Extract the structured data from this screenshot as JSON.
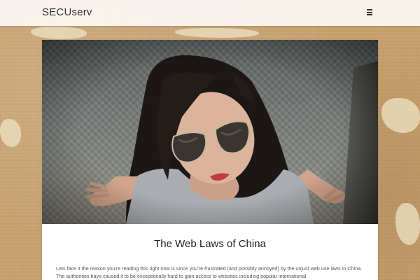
{
  "header": {
    "site_title": "SECUserv",
    "menu_icon": "hamburger-menu-icon"
  },
  "post": {
    "image_subject": "woman-with-aviator-sunglasses-photo",
    "title": "The Web Laws of China",
    "excerpt": "Lets face it the reason you’re reading this right now is since you’re frustrated (and possibly annoyed) by the unjust web use laws in China. The authorities have caused it to be exceptionally hard to gain access to websites including popular international"
  },
  "colors": {
    "header_bg": "#faf6f0",
    "page_bg": "#c9a572",
    "card_bg": "#ffffff",
    "title_text": "#222222",
    "body_text": "#555555"
  }
}
